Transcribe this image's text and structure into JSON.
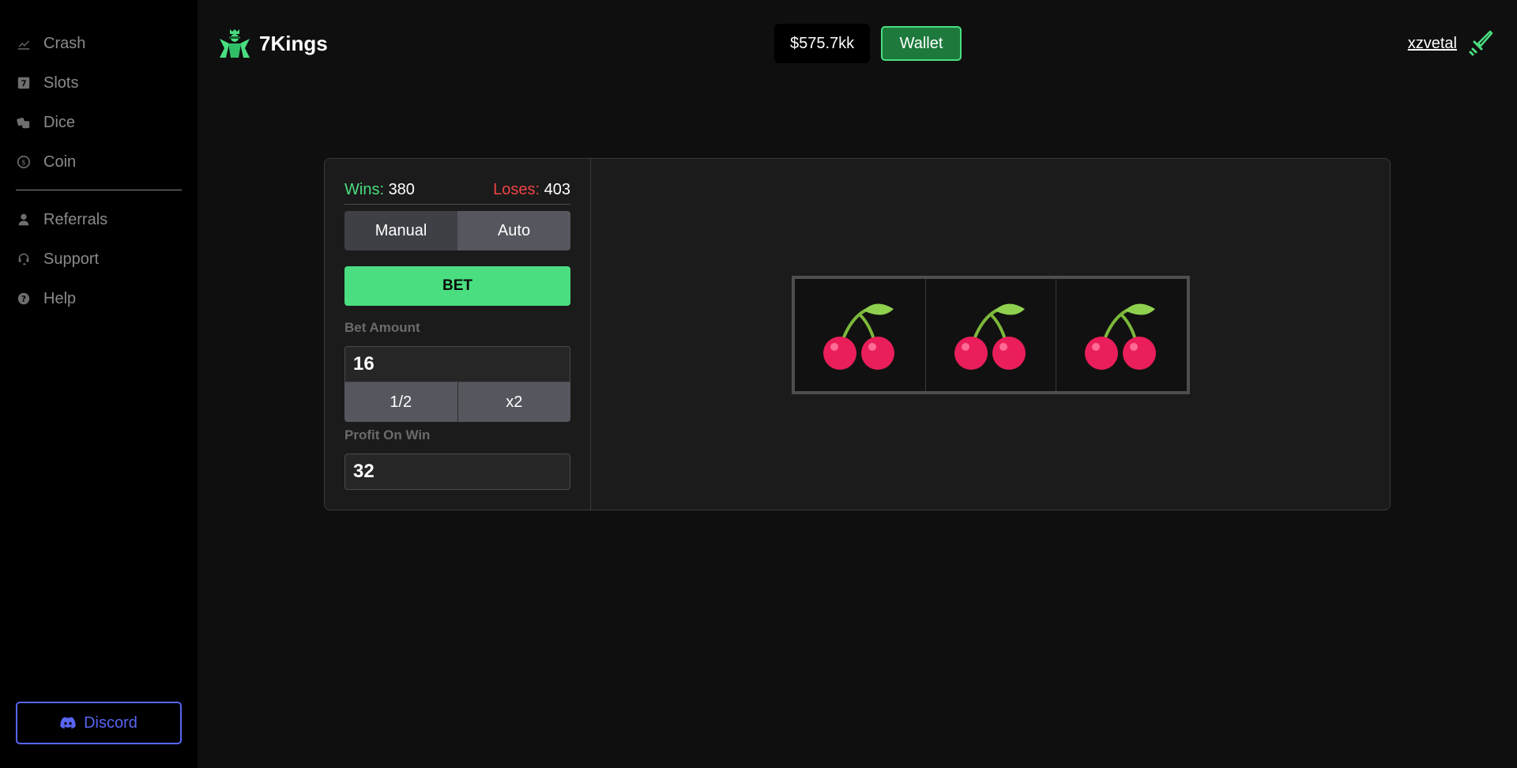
{
  "sidebar": {
    "items": [
      {
        "label": "Crash",
        "icon": "chart-line-icon"
      },
      {
        "label": "Slots",
        "icon": "seven-icon"
      },
      {
        "label": "Dice",
        "icon": "dice-icon"
      },
      {
        "label": "Coin",
        "icon": "coin-icon"
      },
      {
        "label": "Referrals",
        "icon": "user-icon"
      },
      {
        "label": "Support",
        "icon": "headset-icon"
      },
      {
        "label": "Help",
        "icon": "question-icon"
      }
    ],
    "discord_label": "Discord"
  },
  "header": {
    "brand": "7Kings",
    "balance": "$575.7kk",
    "wallet_label": "Wallet",
    "username": "xzvetal"
  },
  "game": {
    "wins_label": "Wins:",
    "wins": "380",
    "loses_label": "Loses:",
    "loses": "403",
    "mode_manual": "Manual",
    "mode_auto": "Auto",
    "bet_label": "BET",
    "bet_amount_label": "Bet Amount",
    "bet_amount": "16",
    "half_label": "1/2",
    "double_label": "x2",
    "profit_label": "Profit On Win",
    "profit": "32",
    "reels": [
      "cherries-icon",
      "cherries-icon",
      "cherries-icon"
    ]
  },
  "colors": {
    "accent": "#4ade80",
    "loss": "#ef4444",
    "discord": "#5865f2",
    "wallet_bg": "#1d7a3c"
  }
}
